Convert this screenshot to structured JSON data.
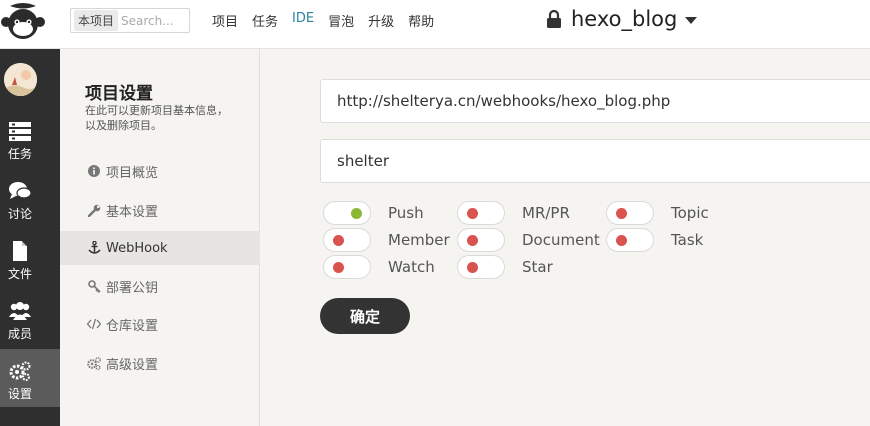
{
  "header": {
    "search_scope": "本项目",
    "search_placeholder": "Search...",
    "nav": [
      "项目",
      "任务",
      "IDE",
      "冒泡",
      "升级",
      "帮助"
    ],
    "project_name": "hexo_blog"
  },
  "sidebar": {
    "items": [
      {
        "label": "任务",
        "icon": "task-icon"
      },
      {
        "label": "讨论",
        "icon": "discussion-icon"
      },
      {
        "label": "文件",
        "icon": "file-icon"
      },
      {
        "label": "成员",
        "icon": "members-icon"
      },
      {
        "label": "设置",
        "icon": "settings-icon",
        "active": true
      }
    ]
  },
  "settings": {
    "title": "项目设置",
    "description": "在此可以更新项目基本信息，以及删除项目。",
    "menu": [
      {
        "label": "项目概览",
        "icon": "info-icon"
      },
      {
        "label": "基本设置",
        "icon": "wrench-icon"
      },
      {
        "label": "WebHook",
        "icon": "anchor-icon",
        "active": true
      },
      {
        "label": "部署公钥",
        "icon": "key-icon"
      },
      {
        "label": "仓库设置",
        "icon": "code-icon"
      },
      {
        "label": "高级设置",
        "icon": "cogs-icon"
      }
    ]
  },
  "webhook": {
    "url": "http://shelterya.cn/webhooks/hexo_blog.php",
    "token": "shelter",
    "events": [
      {
        "label": "Push",
        "enabled": true
      },
      {
        "label": "MR/PR",
        "enabled": false
      },
      {
        "label": "Topic",
        "enabled": false
      },
      {
        "label": "Member",
        "enabled": false
      },
      {
        "label": "Document",
        "enabled": false
      },
      {
        "label": "Task",
        "enabled": false
      },
      {
        "label": "Watch",
        "enabled": false
      },
      {
        "label": "Star",
        "enabled": false
      }
    ],
    "confirm_label": "确定"
  },
  "colors": {
    "toggle_on": "#8ab833",
    "toggle_off": "#d9534f",
    "sidebar_bg": "#2f2f2f",
    "ide_link": "#2c84a0"
  }
}
